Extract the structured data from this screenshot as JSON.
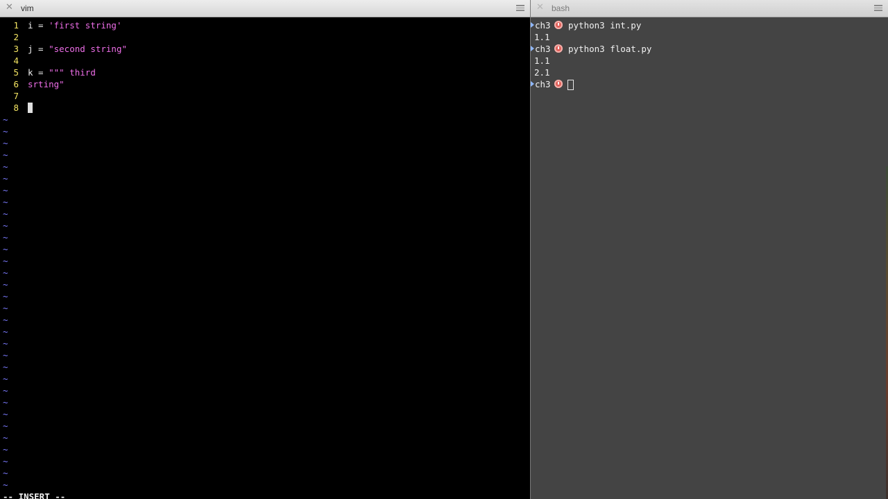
{
  "panes": {
    "vim": {
      "tab_title": "vim"
    },
    "bash": {
      "tab_title": "bash"
    }
  },
  "vim": {
    "lines": [
      {
        "num": "1",
        "pre": "i = ",
        "str": "'first string'"
      },
      {
        "num": "2",
        "pre": "",
        "str": ""
      },
      {
        "num": "3",
        "pre": "j = ",
        "str": "\"second string\""
      },
      {
        "num": "4",
        "pre": "",
        "str": ""
      },
      {
        "num": "5",
        "pre": "k = ",
        "str": "\"\"\" third"
      },
      {
        "num": "6",
        "pre": "",
        "str": "srting\""
      },
      {
        "num": "7",
        "pre": "",
        "str": ""
      },
      {
        "num": "8",
        "pre": "",
        "str": ""
      }
    ],
    "empty_marker": "~",
    "mode_status": "-- INSERT --"
  },
  "bash": {
    "lines": [
      {
        "type": "prompt",
        "cwd": "ch3",
        "cmd": "python3 int.py"
      },
      {
        "type": "output",
        "text": "1.1"
      },
      {
        "type": "prompt",
        "cwd": "ch3",
        "cmd": "python3 float.py"
      },
      {
        "type": "output",
        "text": "1.1"
      },
      {
        "type": "output",
        "text": "2.1"
      },
      {
        "type": "prompt",
        "cwd": "ch3",
        "cmd": ""
      }
    ]
  },
  "colors": {
    "vim_background": "#000000",
    "line_number": "#f5e663",
    "string": "#ee6ee8",
    "tilde": "#7b7bff",
    "bash_background": "#444444",
    "prompt_arrow": "#8fb8ff",
    "clock_icon": "#e0605a"
  }
}
